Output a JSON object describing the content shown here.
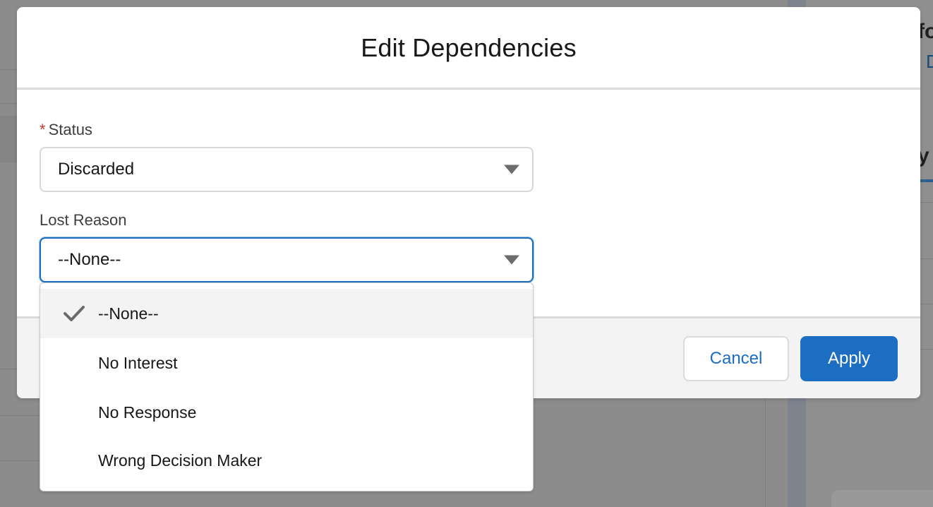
{
  "modal": {
    "title": "Edit Dependencies",
    "cancel_label": "Cancel",
    "apply_label": "Apply"
  },
  "fields": {
    "status": {
      "required_marker": "*",
      "label": "Status",
      "value": "Discarded"
    },
    "lost_reason": {
      "label": "Lost Reason",
      "value": "--None--"
    }
  },
  "dropdown": {
    "options": [
      {
        "label": "--None--",
        "selected": true
      },
      {
        "label": "No Interest",
        "selected": false
      },
      {
        "label": "No Response",
        "selected": false
      },
      {
        "label": "Wrong Decision Maker",
        "selected": false
      }
    ]
  },
  "colors": {
    "brand_blue": "#1b6ec2",
    "required_red": "#c23934"
  },
  "icons": {
    "caret": "chevron-down-icon",
    "check": "check-icon"
  }
}
